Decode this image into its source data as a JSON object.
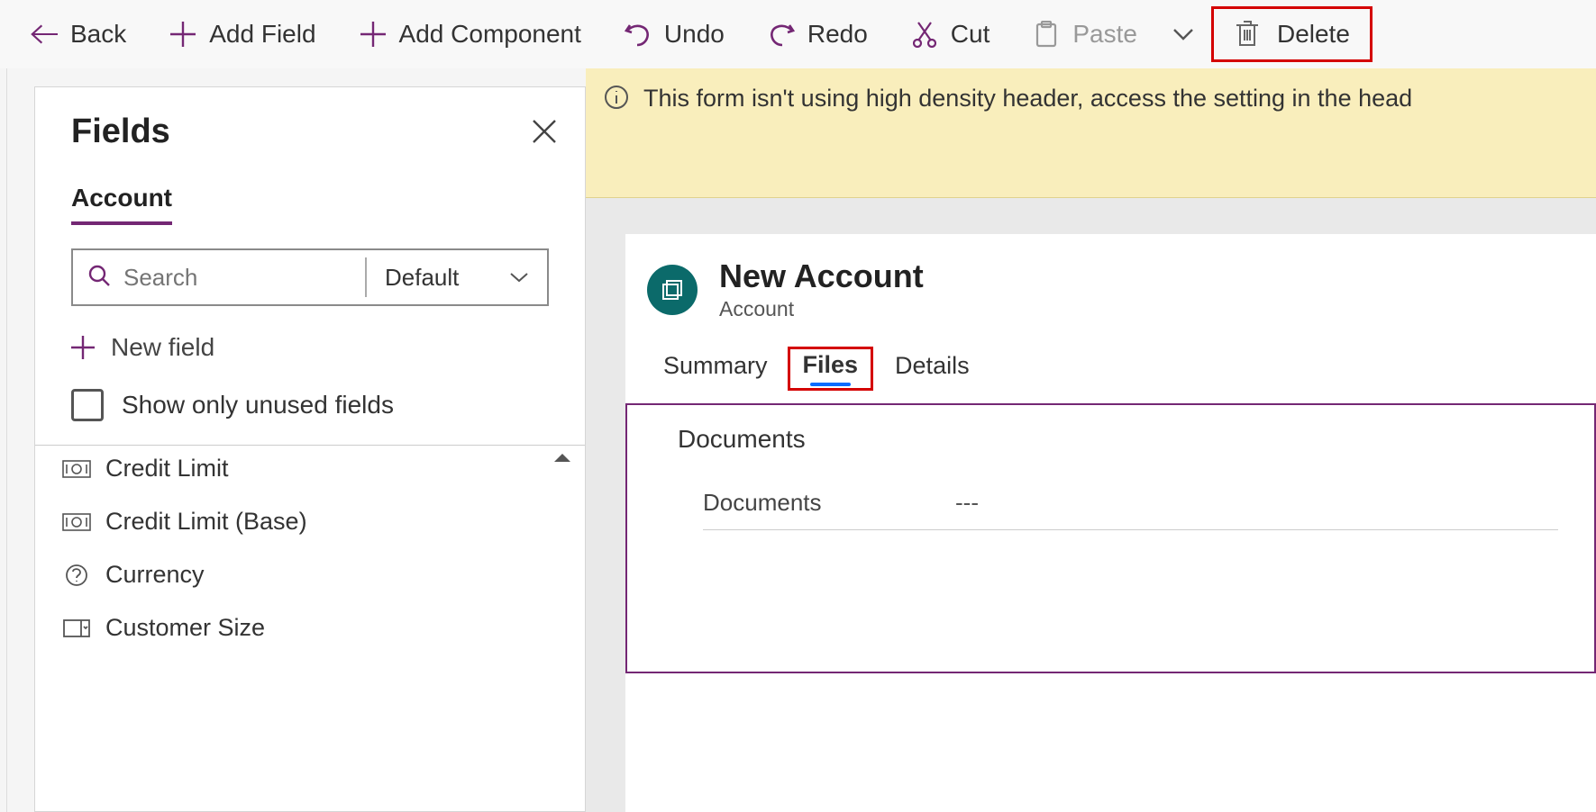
{
  "toolbar": {
    "back": "Back",
    "add_field": "Add Field",
    "add_component": "Add Component",
    "undo": "Undo",
    "redo": "Redo",
    "cut": "Cut",
    "paste": "Paste",
    "delete": "Delete"
  },
  "fields_panel": {
    "title": "Fields",
    "tab": "Account",
    "search_placeholder": "Search",
    "filter_selected": "Default",
    "new_field": "New field",
    "show_unused": "Show only unused fields",
    "items": [
      {
        "label": "Credit Limit"
      },
      {
        "label": "Credit Limit (Base)"
      },
      {
        "label": "Currency"
      },
      {
        "label": "Customer Size"
      }
    ]
  },
  "banner": {
    "text": "This form isn't using high density header, access the setting in the head"
  },
  "form": {
    "title": "New Account",
    "subtitle": "Account",
    "tabs": {
      "summary": "Summary",
      "files": "Files",
      "details": "Details"
    },
    "section": {
      "title": "Documents",
      "row_label": "Documents",
      "row_value": "---"
    }
  }
}
